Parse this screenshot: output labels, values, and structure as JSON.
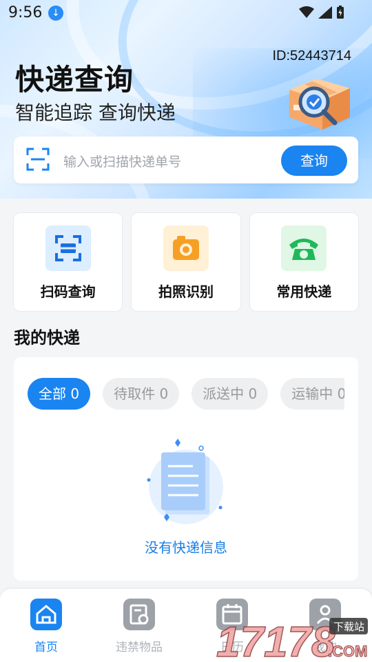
{
  "status_bar": {
    "time": "9:56"
  },
  "header": {
    "user_id": "ID:52443714",
    "title": "快递查询",
    "subtitle": "智能追踪 查询快递"
  },
  "search": {
    "placeholder": "输入或扫描快递单号",
    "button_label": "查询"
  },
  "features": [
    {
      "label": "扫码查询",
      "icon": "scan-icon",
      "color": "#dceeff"
    },
    {
      "label": "拍照识别",
      "icon": "camera-icon",
      "color": "#fff0d6"
    },
    {
      "label": "常用快递",
      "icon": "phone-icon",
      "color": "#dff7e4"
    }
  ],
  "my_express": {
    "section_title": "我的快递",
    "tabs": [
      {
        "label": "全部 0",
        "active": true
      },
      {
        "label": "待取件 0",
        "active": false
      },
      {
        "label": "派送中 0",
        "active": false
      },
      {
        "label": "运输中 0",
        "active": false
      }
    ],
    "empty_text": "没有快递信息"
  },
  "tabbar": [
    {
      "label": "首页",
      "icon": "home-icon",
      "active": true
    },
    {
      "label": "违禁物品",
      "icon": "prohibited-items-icon",
      "active": false
    },
    {
      "label": "日历",
      "icon": "calendar-icon",
      "active": false
    },
    {
      "label": "我的",
      "icon": "user-icon",
      "active": false
    }
  ],
  "watermark": {
    "text": "17178",
    "suffix": ".COM",
    "badge": "下载站"
  },
  "colors": {
    "accent": "#1a84f1",
    "inactive": "#aeb2b8"
  }
}
